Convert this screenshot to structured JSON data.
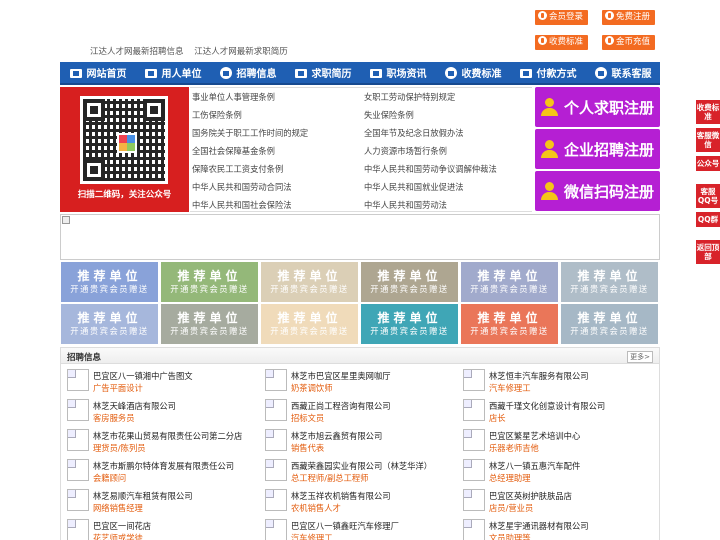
{
  "topbar": {
    "member_login": "会员登录",
    "free_register": "免费注册",
    "fee_standard": "收费标准",
    "gold_recharge": "金币充值"
  },
  "toplinks": [
    "江达人才网最新招聘信息",
    "江达人才网最新求职简历"
  ],
  "nav": [
    {
      "label": "网站首页",
      "icon": "home-icon"
    },
    {
      "label": "用人单位",
      "icon": "building-icon"
    },
    {
      "label": "招聘信息",
      "icon": "speaker-icon"
    },
    {
      "label": "求职简历",
      "icon": "resume-icon"
    },
    {
      "label": "职场资讯",
      "icon": "news-icon"
    },
    {
      "label": "收费标准",
      "icon": "yen-icon"
    },
    {
      "label": "付款方式",
      "icon": "card-icon"
    },
    {
      "label": "联系客服",
      "icon": "phone-icon"
    }
  ],
  "qr_caption": "扫描二维码，关注公众号",
  "laws": [
    "事业单位人事管理条例",
    "女职工劳动保护特别规定",
    "工伤保险条例",
    "失业保险条例",
    "国务院关于职工工作时间的规定",
    "全国年节及纪念日放假办法",
    "全国社会保障基金条例",
    "人力资源市场暂行条例",
    "保障农民工工资支付条例",
    "中华人民共和国劳动争议调解仲裁法",
    "中华人民共和国劳动合同法",
    "中华人民共和国就业促进法",
    "中华人民共和国社会保险法",
    "中华人民共和国劳动法"
  ],
  "register": {
    "personal": "个人求职注册",
    "company": "企业招聘注册",
    "wechat": "微信扫码注册"
  },
  "recommend": {
    "title": "推荐单位",
    "sub": "开通贵宾会员赠送"
  },
  "side": [
    {
      "label": "收费标准"
    },
    {
      "label": "客服微信"
    },
    {
      "label": "公众号"
    },
    {
      "label": "客服QQ号"
    },
    {
      "label": "QQ群"
    },
    {
      "label": "返回顶部"
    }
  ],
  "jobs": {
    "title": "招聘信息",
    "more": "更多>",
    "items": [
      {
        "company": "巴宜区八一镇湘中广告图文",
        "position": "广告平面设计"
      },
      {
        "company": "林芝市巴宜区星里奥网咖厅",
        "position": "奶茶调饮师"
      },
      {
        "company": "林芝恒丰汽车服务有限公司",
        "position": "汽车修理工"
      },
      {
        "company": "林芝天峰酒店有限公司",
        "position": "客房服务员"
      },
      {
        "company": "西藏正尚工程咨询有限公司",
        "position": "招标文员"
      },
      {
        "company": "西藏千瑾文化创意设计有限公司",
        "position": "店长"
      },
      {
        "company": "林芝市花果山贸易有限责任公司第二分店",
        "position": "理货员/陈列员"
      },
      {
        "company": "林芝市旭云鑫贸有限公司",
        "position": "销售代表"
      },
      {
        "company": "巴宜区繁星艺术培训中心",
        "position": "乐器老师吉他"
      },
      {
        "company": "林芝市斯鹏尔特体育发展有限责任公司",
        "position": "会籍顾问"
      },
      {
        "company": "西藏荣鑫园实业有限公司（林芝华洋）",
        "position": "总工程师/副总工程师"
      },
      {
        "company": "林芝八一镇五惠汽车配件",
        "position": "总经理助理"
      },
      {
        "company": "林芝易顺汽车租赁有限公司",
        "position": "网络销售经理"
      },
      {
        "company": "林芝玉祥农机销售有限公司",
        "position": "农机销售人才"
      },
      {
        "company": "巴宜区英树护肤肤品店",
        "position": "店员/营业员"
      },
      {
        "company": "巴宜区一间花店",
        "position": "花艺师或学徒"
      },
      {
        "company": "巴宜区八一镇鑫旺汽车修理厂",
        "position": "汽车修理工"
      },
      {
        "company": "林芝星宇通讯器材有限公司",
        "position": "文员助理等"
      }
    ]
  },
  "colors": {
    "accent_orange": "#f36b21",
    "nav_blue": "#1f5fb3",
    "register_purple": "#b51fd3",
    "side_red": "#d8232a",
    "position_orange": "#e35c0e"
  }
}
